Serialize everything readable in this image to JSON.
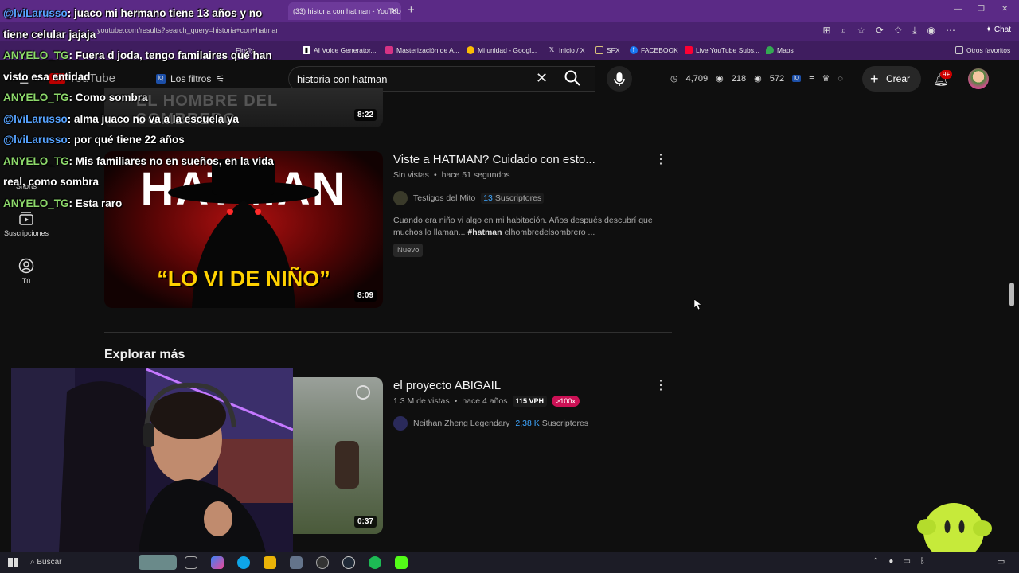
{
  "browser": {
    "tab_title": "(33) historia con hatman - YouTube",
    "url": "youtube.com/results?search_query=historia+con+hatman",
    "chat_label": "Chat",
    "bookmarks": [
      {
        "label": "Firefly",
        "icon": "firefly-icon",
        "color": "#e56b2a"
      },
      {
        "label": "AI Voice Generator...",
        "icon": "bookmark-icon",
        "color": "#ffffff"
      },
      {
        "label": "Masterización de A...",
        "icon": "bookmark-icon",
        "color": "#d63384"
      },
      {
        "label": "Mi unidad - Googl...",
        "icon": "drive-icon",
        "color": "#fbbc04"
      },
      {
        "label": "Inicio / X",
        "icon": "x-icon",
        "color": "#000000"
      },
      {
        "label": "SFX",
        "icon": "folder-icon",
        "color": "#d8c27a"
      },
      {
        "label": "FACEBOOK",
        "icon": "facebook-icon",
        "color": "#1877f2"
      },
      {
        "label": "Live YouTube Subs...",
        "icon": "youtube-icon",
        "color": "#ff0033"
      },
      {
        "label": "Maps",
        "icon": "maps-icon",
        "color": "#34a853"
      }
    ],
    "other_favorites": "Otros favoritos"
  },
  "youtube": {
    "logo_text": "YouTube",
    "filters_label": "Los filtros",
    "search_value": "historia con hatman",
    "stats": {
      "views_clock": "4,709",
      "views_eye": "218",
      "views_eye2": "572"
    },
    "create_label": "Crear",
    "notification_badge": "9+",
    "nav": [
      {
        "label": "Shorts",
        "icon": "shorts-icon"
      },
      {
        "label": "Suscripciones",
        "icon": "subscriptions-icon"
      },
      {
        "label": "Tú",
        "icon": "account-icon"
      }
    ]
  },
  "results": {
    "top_partial": {
      "thumb_text": "EL HOMBRE DEL SOMBRERO",
      "duration": "8:22"
    },
    "video1": {
      "title": "Viste a HATMAN? Cuidado con esto...",
      "views": "Sin vistas",
      "age": "hace 51 segundos",
      "channel": "Testigos del Mito",
      "subs_count": "13",
      "subs_label": "Suscriptores",
      "description": "Cuando era niño vi algo en mi habitación. Años después descubrí que muchos lo llaman... ",
      "hashtag": "#hatman",
      "desc_rest": " elhombredelsombrero ...",
      "chip": "Nuevo",
      "thumb_top": "HATMAN",
      "thumb_bottom": "“LO VI DE NIÑO”",
      "duration": "8:09"
    },
    "explore_heading": "Explorar más",
    "video2": {
      "title": "el proyecto ABIGAIL",
      "views": "1.3 M de vistas",
      "age": "hace 4 años",
      "vph": "115 VPH",
      "ratio": ">100x",
      "channel": "Neithan Zheng Legendary",
      "subs_count": "2,38 K",
      "subs_label": "Suscriptores",
      "duration": "0:37"
    }
  },
  "stream_chat": [
    {
      "user": "@lviLarusso",
      "text": ": juaco mi hermano tiene 13 años y no tiene celular jajaja",
      "kind": "mention"
    },
    {
      "user": "ANYELO_TG",
      "text": ": Fuera d joda, tengo familaires qué han visto esa entidad",
      "kind": "mod"
    },
    {
      "user": "ANYELO_TG",
      "text": ": Como sombra",
      "kind": "mod"
    },
    {
      "user": "@lviLarusso",
      "text": ": alma juaco no va a la escuela ya",
      "kind": "mention"
    },
    {
      "user": "@lviLarusso",
      "text": ": por qué tiene 22 años",
      "kind": "mention"
    },
    {
      "user": "ANYELO_TG",
      "text": ": Mis familiares no en sueños, en la vida real, como sombra",
      "kind": "mod"
    },
    {
      "user": "ANYELO_TG",
      "text": ": Esta raro",
      "kind": "mod"
    }
  ],
  "taskbar": {
    "search_label": "Buscar"
  }
}
